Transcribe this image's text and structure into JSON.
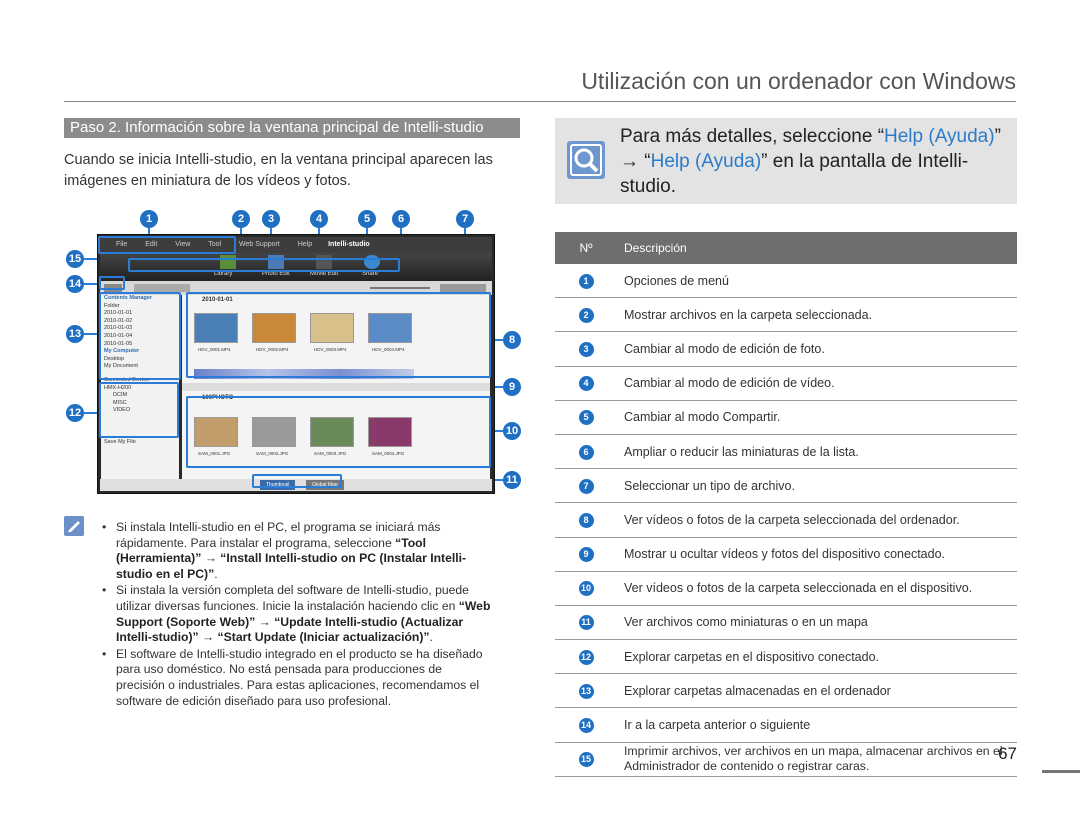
{
  "page": {
    "title": "Utilización con un ordenador con Windows",
    "number": "67"
  },
  "section": {
    "heading": "Paso 2. Información sobre la ventana principal de Intelli-studio",
    "intro_lines": [
      "Cuando se inicia Intelli-studio, en la ventana principal aparecen las",
      "imágenes en miniatura de los vídeos y fotos."
    ]
  },
  "screenshot": {
    "menu_items": [
      "File",
      "Edit",
      "View",
      "Tool",
      "Web Support",
      "Help"
    ],
    "app_name": "Intelli-studio",
    "toolbar_labels": [
      "Library",
      "Photo Edit",
      "Movie Edit",
      "Share"
    ],
    "left_panel": {
      "contents_manager": "Contents Manager",
      "folder": "Folder",
      "dates": [
        "2010-01-01",
        "2010-01-02",
        "2010-01-03",
        "2010-01-04",
        "2010-01-05"
      ],
      "my_computer": "My Computer",
      "my_computer_items": [
        "Desktop",
        "My Document"
      ],
      "connected_device": "Connected Device",
      "device": "HMX-H200",
      "device_folders": [
        "DCIM",
        "MISC",
        "VIDEO"
      ],
      "save_file": "Save My File"
    },
    "main_panel": {
      "pc_date": "2010-01-01",
      "pc_thumb_labels": [
        "HDV_0001.MP4",
        "HDV_0002.MP4",
        "HDV_0003.MP4",
        "HDV_0004.MP4"
      ],
      "device_folder": "100PHOTO",
      "device_thumb_labels": [
        "SAM_0001.JPG",
        "SAM_0002.JPG",
        "SAM_0003.JPG",
        "SAM_0004.JPG"
      ],
      "tabs": [
        "Thumbnail",
        "Global Map"
      ]
    },
    "callouts": [
      "1",
      "2",
      "3",
      "4",
      "5",
      "6",
      "7",
      "8",
      "9",
      "10",
      "11",
      "12",
      "13",
      "14",
      "15"
    ]
  },
  "notes": [
    {
      "lines": [
        [
          {
            "t": "Si instala Intelli-studio en el PC, el programa se iniciará más",
            "b": false
          }
        ],
        [
          {
            "t": "rápidamente. Para instalar el programa, seleccione ",
            "b": false
          },
          {
            "t": "“Tool",
            "b": true
          }
        ],
        [
          {
            "t": "(Herramienta)” → “Install Intelli-studio on PC (Instalar Intelli-",
            "b": true
          }
        ],
        [
          {
            "t": "studio en el PC)”",
            "b": true
          },
          {
            "t": ".",
            "b": false
          }
        ]
      ]
    },
    {
      "lines": [
        [
          {
            "t": "Si instala la versión completa del software de Intelli-studio, puede",
            "b": false
          }
        ],
        [
          {
            "t": "utilizar diversas funciones. Inicie la instalación haciendo clic en ",
            "b": false
          },
          {
            "t": "“Web",
            "b": true
          }
        ],
        [
          {
            "t": "Support (Soporte Web)” → “Update Intelli-studio (Actualizar",
            "b": true
          }
        ],
        [
          {
            "t": "Intelli-studio)” → “Start Update (Iniciar actualización)”",
            "b": true
          },
          {
            "t": ".",
            "b": false
          }
        ]
      ]
    },
    {
      "lines": [
        [
          {
            "t": "El software de Intelli-studio integrado en el producto se ha diseñado",
            "b": false
          }
        ],
        [
          {
            "t": "para uso doméstico. No está pensada para producciones de",
            "b": false
          }
        ],
        [
          {
            "t": "precisión o industriales. Para estas aplicaciones, recomendamos el",
            "b": false
          }
        ],
        [
          {
            "t": "software de edición diseñado para uso profesional.",
            "b": false
          }
        ]
      ]
    }
  ],
  "help": {
    "line1_pre": "Para más detalles, seleccione “",
    "line1_link": "Help (Ayuda)",
    "line1_post": "”",
    "line2_pre": "→ “",
    "line2_link": "Help (Ayuda)",
    "line2_post": "” en la pantalla de Intelli-",
    "line3": "studio."
  },
  "table": {
    "headers": [
      "Nº",
      "Descripción"
    ],
    "rows": [
      {
        "n": "1",
        "d": "Opciones de menú"
      },
      {
        "n": "2",
        "d": "Mostrar archivos en la carpeta seleccionada."
      },
      {
        "n": "3",
        "d": "Cambiar al modo de edición de foto."
      },
      {
        "n": "4",
        "d": "Cambiar al modo de edición de vídeo."
      },
      {
        "n": "5",
        "d": "Cambiar al modo Compartir."
      },
      {
        "n": "6",
        "d": "Ampliar o reducir las miniaturas de la lista."
      },
      {
        "n": "7",
        "d": "Seleccionar un tipo de archivo."
      },
      {
        "n": "8",
        "d": "Ver vídeos o fotos de la carpeta seleccionada del ordenador."
      },
      {
        "n": "9",
        "d": "Mostrar u ocultar vídeos y fotos del dispositivo conectado."
      },
      {
        "n": "10",
        "d": "Ver vídeos o fotos de la carpeta seleccionada en el dispositivo."
      },
      {
        "n": "11",
        "d": "Ver archivos como miniaturas o en un mapa"
      },
      {
        "n": "12",
        "d": "Explorar carpetas en el dispositivo conectado."
      },
      {
        "n": "13",
        "d": "Explorar carpetas almacenadas en el ordenador"
      },
      {
        "n": "14",
        "d": "Ir a la carpeta anterior o siguiente"
      },
      {
        "n": "15",
        "d": "Imprimir archivos, ver archivos en un mapa, almacenar archivos en el Administrador de contenido o registrar caras."
      }
    ]
  },
  "colors": {
    "accent_blue": "#1f6fc2",
    "link_blue": "#2c7bc8",
    "header_gray": "#8c8c8c"
  }
}
